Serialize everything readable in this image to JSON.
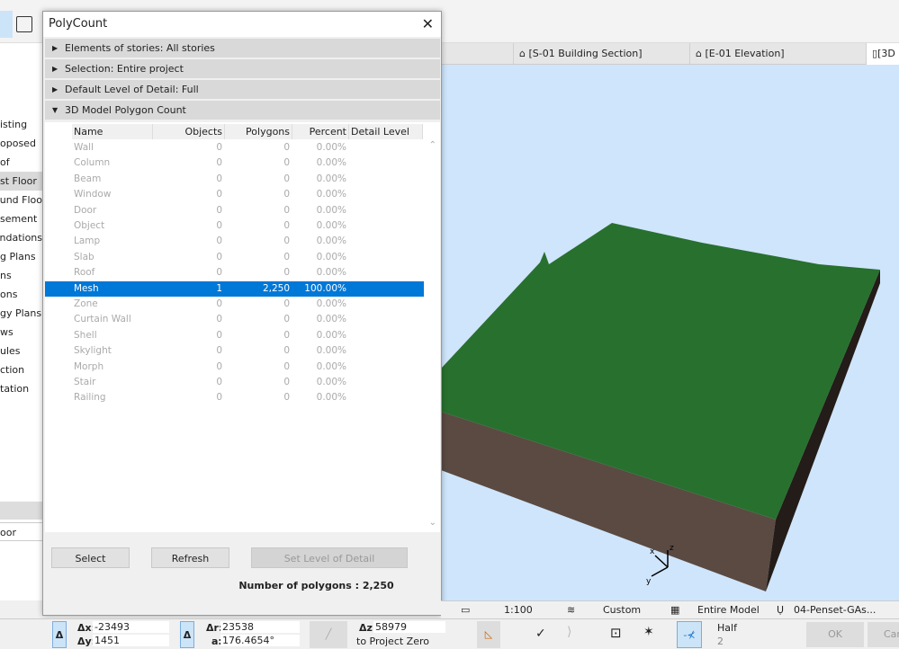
{
  "tabs": [
    "[S-01 Building Section]",
    "[E-01 Elevation]",
    "[3D"
  ],
  "sidebar": {
    "items": [
      "isting",
      "oposed",
      "of",
      "st Floor",
      "round Floo",
      "sement",
      "undations",
      "g Plans",
      "ns",
      "ons",
      "gy Plans",
      "ws",
      "ules",
      "ction",
      "tation"
    ],
    "selected": 3,
    "field": "oor"
  },
  "dialog": {
    "title": "PolyCount",
    "close": "✕",
    "sections": [
      {
        "label": "Elements of stories: All stories",
        "expanded": false
      },
      {
        "label": "Selection: Entire project",
        "expanded": false
      },
      {
        "label": "Default Level of Detail: Full",
        "expanded": false
      },
      {
        "label": "3D Model Polygon Count",
        "expanded": true
      }
    ],
    "columns": [
      "Name",
      "Objects",
      "Polygons",
      "Percent",
      "Detail Level"
    ],
    "rows": [
      [
        "Wall",
        "0",
        "0",
        "0.00%"
      ],
      [
        "Column",
        "0",
        "0",
        "0.00%"
      ],
      [
        "Beam",
        "0",
        "0",
        "0.00%"
      ],
      [
        "Window",
        "0",
        "0",
        "0.00%"
      ],
      [
        "Door",
        "0",
        "0",
        "0.00%"
      ],
      [
        "Object",
        "0",
        "0",
        "0.00%"
      ],
      [
        "Lamp",
        "0",
        "0",
        "0.00%"
      ],
      [
        "Slab",
        "0",
        "0",
        "0.00%"
      ],
      [
        "Roof",
        "0",
        "0",
        "0.00%"
      ],
      [
        "Mesh",
        "1",
        "2,250",
        "100.00%"
      ],
      [
        "Zone",
        "0",
        "0",
        "0.00%"
      ],
      [
        "Curtain Wall",
        "0",
        "0",
        "0.00%"
      ],
      [
        "Shell",
        "0",
        "0",
        "0.00%"
      ],
      [
        "Skylight",
        "0",
        "0",
        "0.00%"
      ],
      [
        "Morph",
        "0",
        "0",
        "0.00%"
      ],
      [
        "Stair",
        "0",
        "0",
        "0.00%"
      ],
      [
        "Railing",
        "0",
        "0",
        "0.00%"
      ]
    ],
    "selected_row": 9,
    "buttons": {
      "select": "Select",
      "refresh": "Refresh",
      "set_lod": "Set Level of Detail"
    },
    "total": "Number of polygons : 2,250"
  },
  "view_bar": {
    "scale": "1:100",
    "layers": "Custom",
    "model": "Entire Model",
    "pen": "04-Penset-GAs..."
  },
  "coords": {
    "dx_label": "Δx:",
    "dx": "-23493",
    "dy_label": "Δy:",
    "dy": "1451",
    "dr_label": "Δr:",
    "dr": "23538",
    "a_label": "a:",
    "a": "176.4654°",
    "dz_label": "Δz:",
    "dz": "58979",
    "ref": "to Project Zero"
  },
  "snap": {
    "label": "Half",
    "value": "2"
  },
  "actions": {
    "ok": "OK",
    "cancel": "Can"
  },
  "axes": {
    "x": "x",
    "y": "y",
    "z": "z"
  },
  "colors": {
    "selection": "#0078d7",
    "terrain": "#28702e",
    "soil": "#5a4a42",
    "sky": "#cfe5fb"
  }
}
